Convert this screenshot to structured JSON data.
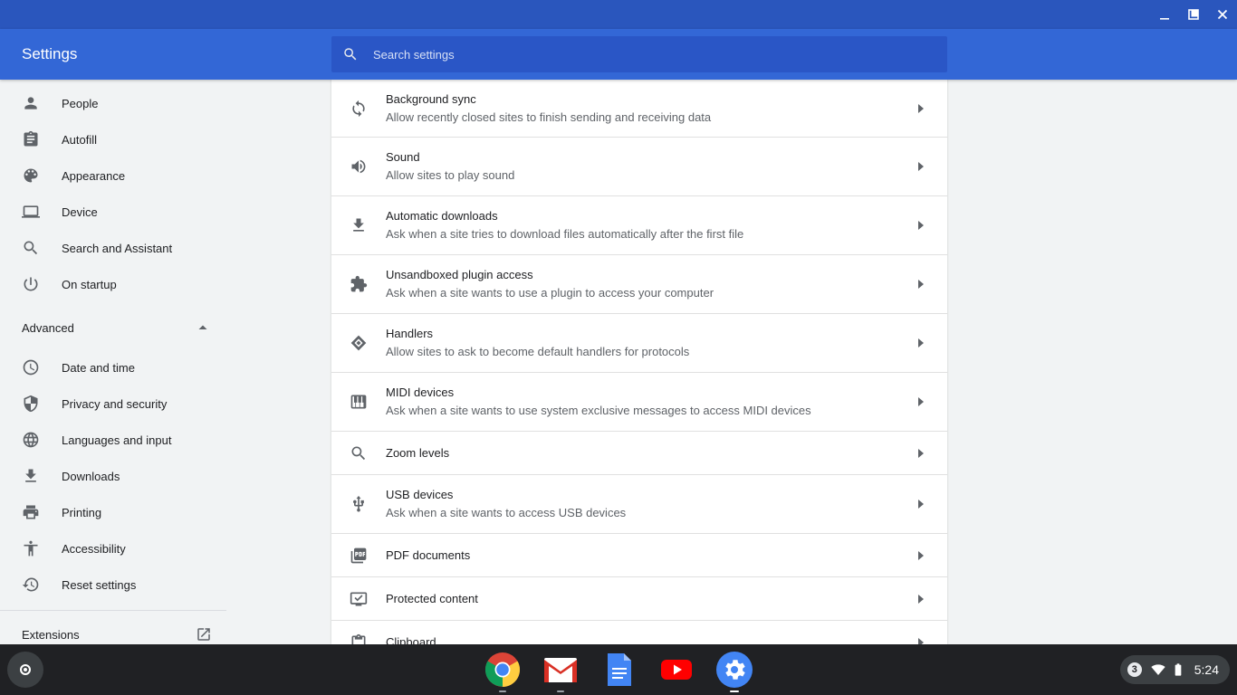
{
  "window": {
    "minimize_label": "minimize",
    "maximize_label": "restore",
    "close_label": "close"
  },
  "header": {
    "title": "Settings",
    "search_placeholder": "Search settings"
  },
  "sidebar": {
    "items": [
      {
        "label": "People",
        "icon": "person-icon"
      },
      {
        "label": "Autofill",
        "icon": "clipboard-icon"
      },
      {
        "label": "Appearance",
        "icon": "palette-icon"
      },
      {
        "label": "Device",
        "icon": "laptop-icon"
      },
      {
        "label": "Search and Assistant",
        "icon": "search-icon"
      },
      {
        "label": "On startup",
        "icon": "power-icon"
      }
    ],
    "advanced_label": "Advanced",
    "advanced_items": [
      {
        "label": "Date and time",
        "icon": "clock-icon"
      },
      {
        "label": "Privacy and security",
        "icon": "shield-icon"
      },
      {
        "label": "Languages and input",
        "icon": "globe-icon"
      },
      {
        "label": "Downloads",
        "icon": "download-icon"
      },
      {
        "label": "Printing",
        "icon": "printer-icon"
      },
      {
        "label": "Accessibility",
        "icon": "accessibility-icon"
      },
      {
        "label": "Reset settings",
        "icon": "history-icon"
      }
    ],
    "extensions_label": "Extensions"
  },
  "content": {
    "rows": [
      {
        "title": "Background sync",
        "subtitle": "Allow recently closed sites to finish sending and receiving data",
        "icon": "sync-icon"
      },
      {
        "title": "Sound",
        "subtitle": "Allow sites to play sound",
        "icon": "volume-icon"
      },
      {
        "title": "Automatic downloads",
        "subtitle": "Ask when a site tries to download files automatically after the first file",
        "icon": "download-icon"
      },
      {
        "title": "Unsandboxed plugin access",
        "subtitle": "Ask when a site wants to use a plugin to access your computer",
        "icon": "puzzle-icon"
      },
      {
        "title": "Handlers",
        "subtitle": "Allow sites to ask to become default handlers for protocols",
        "icon": "handler-icon"
      },
      {
        "title": "MIDI devices",
        "subtitle": "Ask when a site wants to use system exclusive messages to access MIDI devices",
        "icon": "piano-icon"
      },
      {
        "title": "Zoom levels",
        "subtitle": "",
        "icon": "zoom-icon"
      },
      {
        "title": "USB devices",
        "subtitle": "Ask when a site wants to access USB devices",
        "icon": "usb-icon"
      },
      {
        "title": "PDF documents",
        "subtitle": "",
        "icon": "pdf-icon"
      },
      {
        "title": "Protected content",
        "subtitle": "",
        "icon": "protected-content-icon"
      },
      {
        "title": "Clipboard",
        "subtitle": "",
        "icon": "clipboard-icon"
      }
    ]
  },
  "shelf": {
    "apps": [
      {
        "name": "Chrome",
        "icon": "chrome-icon"
      },
      {
        "name": "Gmail",
        "icon": "gmail-icon"
      },
      {
        "name": "Docs",
        "icon": "docs-icon"
      },
      {
        "name": "YouTube",
        "icon": "youtube-icon"
      },
      {
        "name": "Settings",
        "icon": "settings-gear-icon"
      }
    ],
    "notification_count": "3",
    "time": "5:24"
  },
  "colors": {
    "titlebar": "#2a56bd",
    "header": "#3367d6",
    "search_box": "#2a56c6",
    "sidebar_bg": "#f1f3f4",
    "shelf_bg": "#202124"
  }
}
